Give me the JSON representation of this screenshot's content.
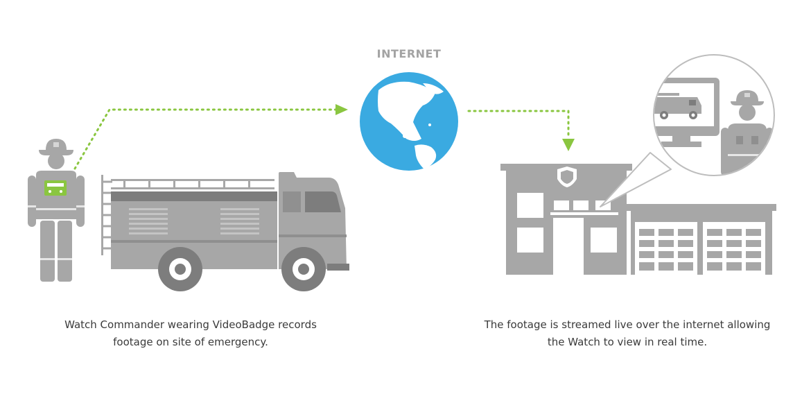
{
  "internet_label": "INTERNET",
  "caption_left": {
    "line1": "Watch Commander wearing VideoBadge records",
    "line2": "footage on site of emergency."
  },
  "caption_right": {
    "line1": "The footage is streamed live over the internet allowing",
    "line2": "the Watch to view in real time."
  },
  "colors": {
    "gray": "#a7a7a7",
    "dark_gray": "#7d7d7d",
    "light_gray": "#bdbdbd",
    "green": "#8ac640",
    "globe": "#3aaae1",
    "text": "#3a3a3a"
  }
}
